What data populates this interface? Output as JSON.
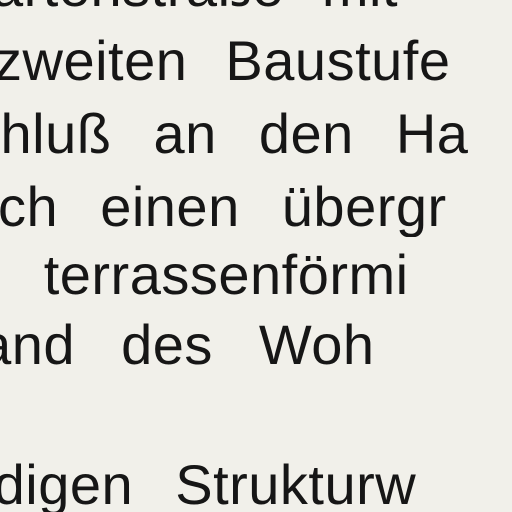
{
  "document": {
    "lines": [
      "artenstraße mit",
      "zweiten Baustufe",
      "chluß an den Ha",
      "ch einen übergr",
      "n terrassenförmi",
      "rland des Woh",
      "ndigen Strukturw"
    ]
  }
}
